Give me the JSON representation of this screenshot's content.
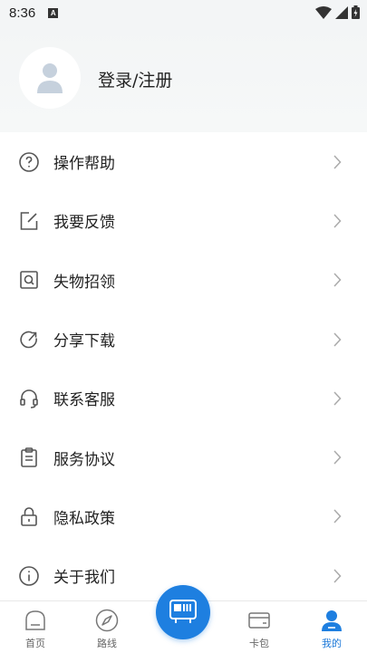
{
  "status": {
    "time": "8:36",
    "notif_icon": "A"
  },
  "profile": {
    "login_label": "登录/注册"
  },
  "menu": {
    "items": [
      {
        "label": "操作帮助",
        "icon": "help-circle-icon"
      },
      {
        "label": "我要反馈",
        "icon": "edit-icon"
      },
      {
        "label": "失物招领",
        "icon": "search-box-icon"
      },
      {
        "label": "分享下载",
        "icon": "share-icon"
      },
      {
        "label": "联系客服",
        "icon": "headset-icon"
      },
      {
        "label": "服务协议",
        "icon": "clipboard-icon"
      },
      {
        "label": "隐私政策",
        "icon": "lock-icon"
      },
      {
        "label": "关于我们",
        "icon": "info-icon"
      }
    ]
  },
  "tabbar": {
    "tabs": [
      {
        "label": "首页",
        "icon": "home-icon"
      },
      {
        "label": "路线",
        "icon": "navigation-icon"
      },
      {
        "label": "卡包",
        "icon": "card-icon"
      },
      {
        "label": "我的",
        "icon": "user-icon"
      }
    ],
    "active": "我的",
    "center_icon": "qr-bus-icon"
  },
  "colors": {
    "accent": "#1e7fe0",
    "icon_gray": "#555555",
    "chevron": "#aaaaaa"
  }
}
